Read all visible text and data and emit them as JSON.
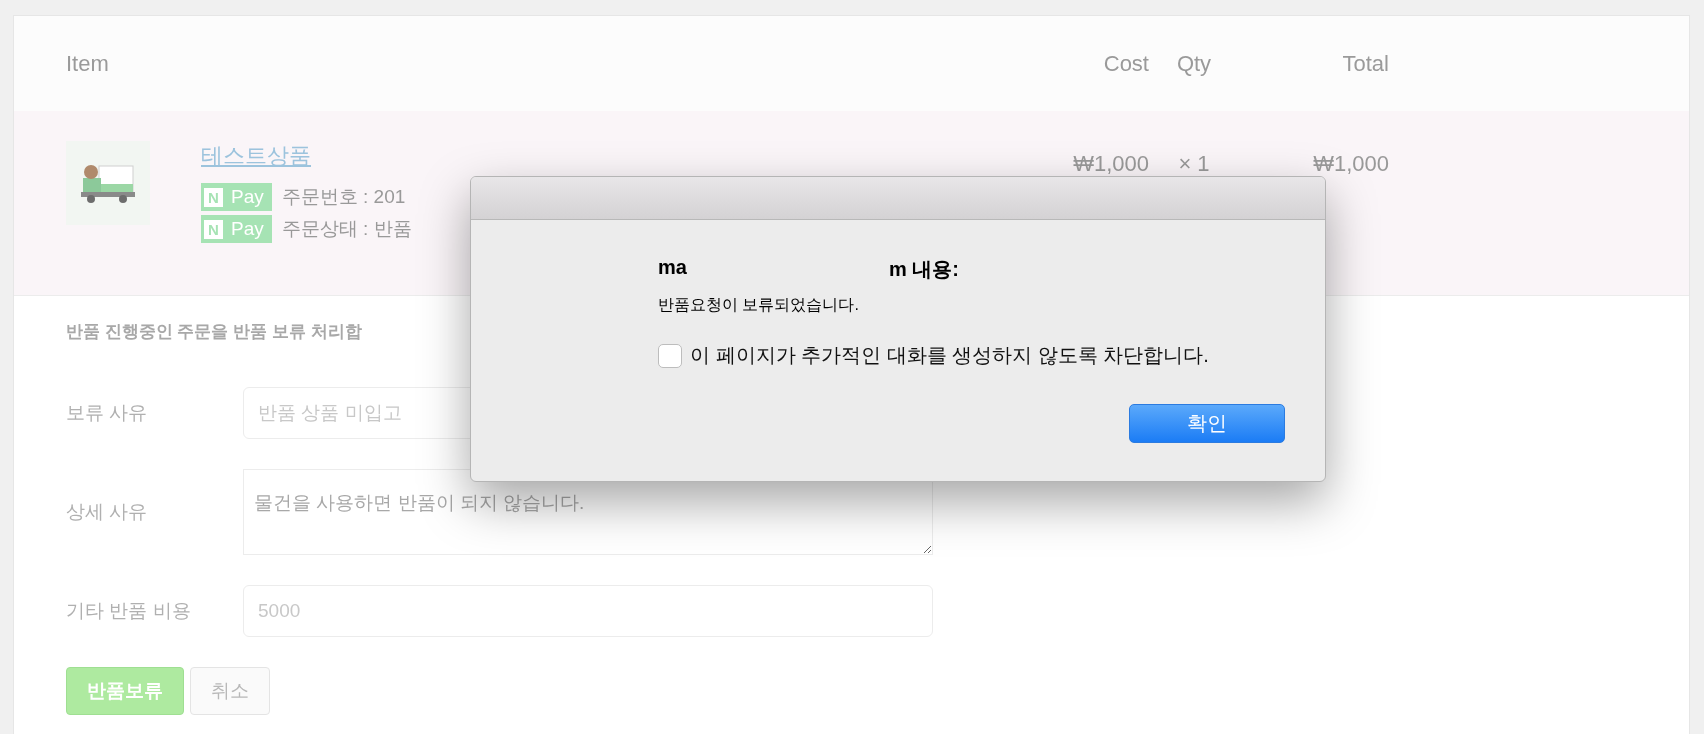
{
  "table": {
    "columns": [
      "Item",
      "Cost",
      "Qty",
      "Total"
    ],
    "rows": [
      {
        "name": "테스트상품",
        "cost": "₩1,000",
        "qty": "× 1",
        "total": "₩1,000",
        "badges": [
          {
            "brand": "N",
            "label": "Pay",
            "text": "주문번호 : 201"
          },
          {
            "brand": "N",
            "label": "Pay",
            "text": "주문상태 : 반품"
          }
        ]
      }
    ]
  },
  "form": {
    "intro": "반품 진행중인 주문을 반품 보류 처리합",
    "fields": [
      {
        "kind": "input",
        "label": "보류 사유",
        "value": "반품 상품 미입고"
      },
      {
        "kind": "textarea",
        "label": "상세 사유",
        "placeholder": "물건을 사용하면 반품이 되지 않습니다."
      },
      {
        "kind": "input",
        "label": "기타 반품 비용",
        "value": "5000"
      }
    ],
    "buttons": [
      {
        "label": "반품보류",
        "kind": "primary"
      },
      {
        "label": "취소",
        "kind": "default"
      }
    ]
  },
  "dialog": {
    "title_start": "ma",
    "title_end": "m 내용:",
    "message": "반품요청이 보류되었습니다.",
    "checkbox": {
      "label": "이 페이지가 추가적인 대화를 생성하지 않도록 차단합니다.",
      "checked": false
    },
    "button": "확인"
  }
}
